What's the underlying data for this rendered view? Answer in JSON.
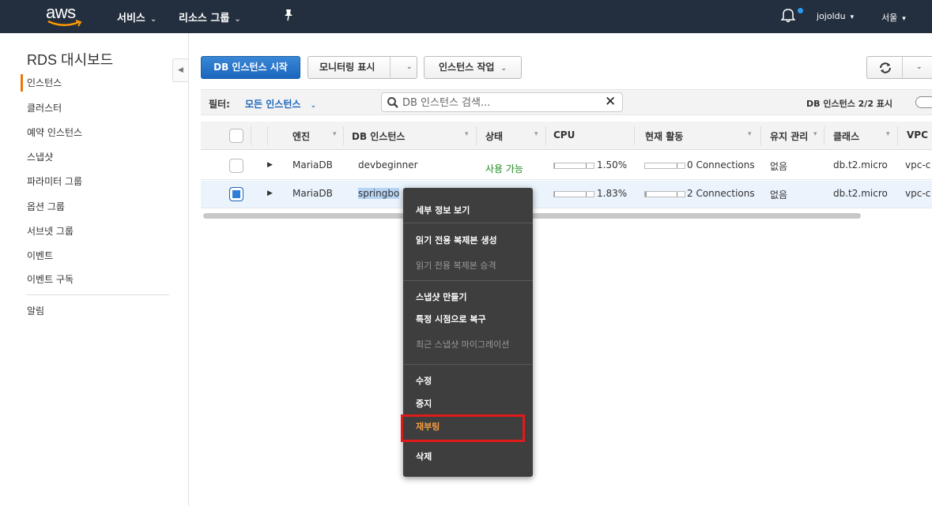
{
  "topnav": {
    "logo_text": "aws",
    "services": "서비스",
    "resource_groups": "리소스 그룹",
    "user": "jojoldu",
    "region": "서울",
    "colors": {
      "bg": "#232f3e",
      "logo_smile": "#ff9900",
      "notification_dot": "#2b9af3"
    }
  },
  "sidebar": {
    "title": "RDS 대시보드",
    "items": [
      "인스턴스",
      "클러스터",
      "예약 인스턴스",
      "스냅샷",
      "파라미터 그룹",
      "옵션 그룹",
      "서브넷 그룹",
      "이벤트",
      "이벤트 구독"
    ],
    "extra": "알림",
    "active_index": 0
  },
  "toolbar": {
    "launch": "DB 인스턴스 시작",
    "monitoring": "모니터링 표시",
    "actions": "인스턴스 작업"
  },
  "filter": {
    "label": "필터:",
    "value": "모든 인스턴스",
    "search_placeholder": "DB 인스턴스 검색...",
    "count_text": "DB 인스턴스 2/2 표시"
  },
  "table": {
    "headers": [
      "엔진",
      "DB 인스턴스",
      "상태",
      "CPU",
      "현재 활동",
      "유지 관리",
      "클래스",
      "VPC"
    ],
    "rows": [
      {
        "engine": "MariaDB",
        "instance": "devbeginner",
        "status": "사용 가능",
        "cpu": "1.50%",
        "cpu_pct": 1.5,
        "activity": "0 Connections",
        "activity_level": 0,
        "maintenance": "없음",
        "class": "db.t2.micro",
        "vpc": "vpc-c",
        "checked": false
      },
      {
        "engine": "MariaDB",
        "instance": "springbo",
        "status": "",
        "cpu": "1.83%",
        "cpu_pct": 1.83,
        "activity": "2 Connections",
        "activity_level": 2,
        "maintenance": "없음",
        "class": "db.t2.micro",
        "vpc": "vpc-c",
        "checked": true
      }
    ]
  },
  "context_menu": {
    "items": [
      {
        "label": "세부 정보 보기",
        "enabled": true
      },
      {
        "label": "읽기 전용 복제본 생성",
        "enabled": true
      },
      {
        "label": "읽기 전용 복제본 승격",
        "enabled": false
      },
      {
        "label": "스냅샷 만들기",
        "enabled": true
      },
      {
        "label": "특정 시점으로 복구",
        "enabled": true
      },
      {
        "label": "최근 스냅샷 마이그레이션",
        "enabled": false
      },
      {
        "label": "수정",
        "enabled": true
      },
      {
        "label": "중지",
        "enabled": true
      },
      {
        "label": "재부팅",
        "enabled": true,
        "highlighted": true
      },
      {
        "label": "삭제",
        "enabled": true
      }
    ],
    "highlight_color": "#e01b1b",
    "highlight_text_color": "#f39c3e"
  }
}
